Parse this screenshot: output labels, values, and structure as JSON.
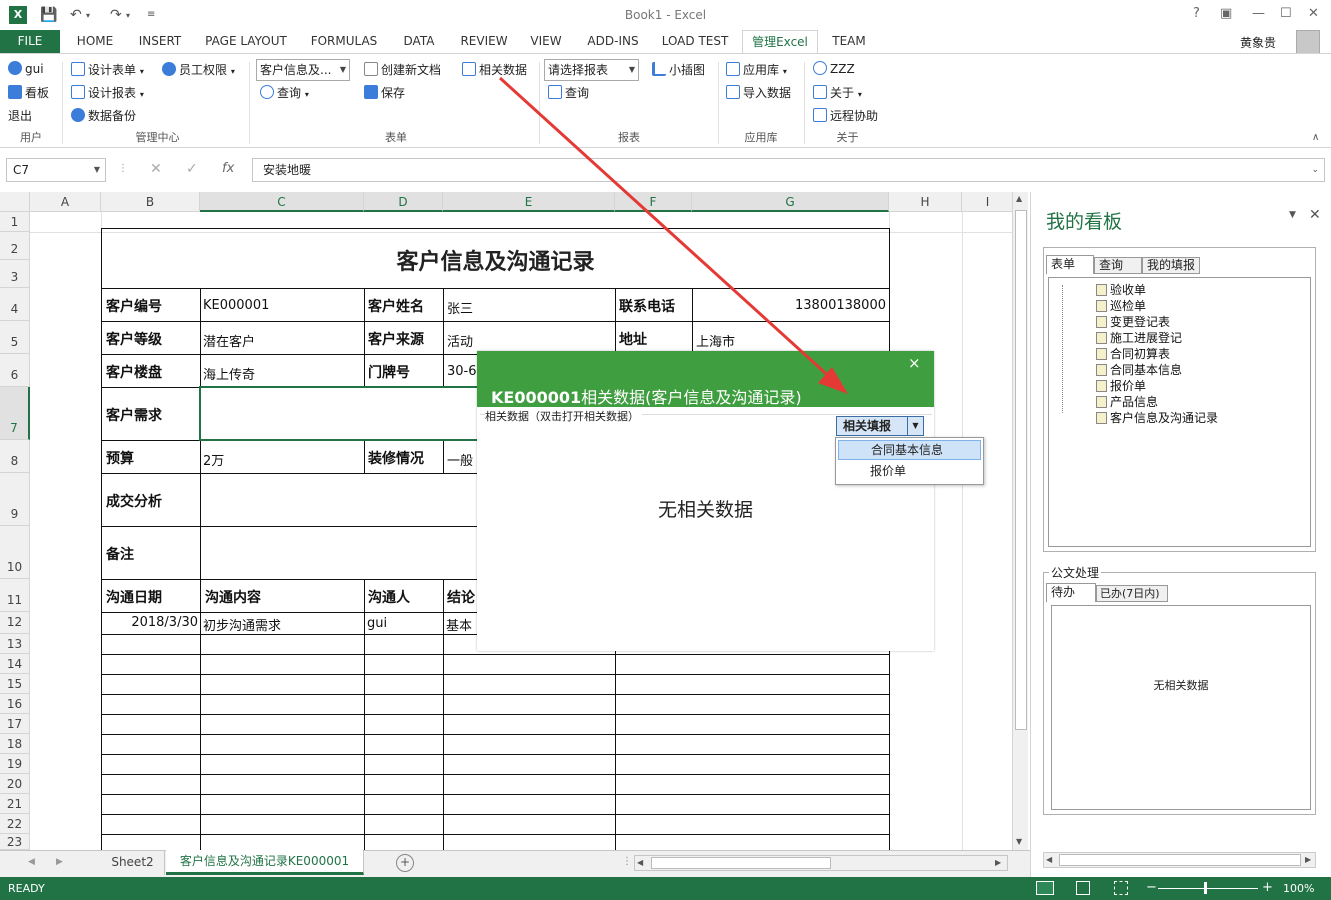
{
  "window": {
    "title": "Book1 - Excel",
    "user": "黄象贵"
  },
  "tabs": [
    {
      "label": "FILE"
    },
    {
      "label": "HOME"
    },
    {
      "label": "INSERT"
    },
    {
      "label": "PAGE LAYOUT"
    },
    {
      "label": "FORMULAS"
    },
    {
      "label": "DATA"
    },
    {
      "label": "REVIEW"
    },
    {
      "label": "VIEW"
    },
    {
      "label": "ADD-INS"
    },
    {
      "label": "LOAD TEST"
    },
    {
      "label": "管理Excel"
    },
    {
      "label": "TEAM"
    }
  ],
  "ribbon": {
    "user": {
      "name": "gui",
      "board": "看板",
      "logout": "退出",
      "group": "用户"
    },
    "admin": {
      "design_form": "设计表单",
      "design_report": "设计报表",
      "backup": "数据备份",
      "staff_perm": "员工权限",
      "group": "管理中心"
    },
    "form": {
      "combo": "客户信息及...",
      "query": "查询",
      "new_doc": "创建新文档",
      "save": "保存",
      "related": "相关数据",
      "group": "表单"
    },
    "report": {
      "combo": "请选择报表",
      "query": "查询",
      "chart": "小插图",
      "group": "报表"
    },
    "apps": {
      "library": "应用库",
      "import": "导入数据",
      "group": "应用库"
    },
    "about": {
      "zzz": "ZZZ",
      "about": "关于",
      "remote": "远程协助",
      "group": "关于"
    }
  },
  "formula_bar": {
    "name_box": "C7",
    "formula": "安装地暖"
  },
  "columns": [
    "A",
    "B",
    "C",
    "D",
    "E",
    "F",
    "G",
    "H",
    "I"
  ],
  "rows": [
    "1",
    "2",
    "3",
    "4",
    "5",
    "6",
    "7",
    "8",
    "9",
    "10",
    "11",
    "12",
    "13",
    "14",
    "15",
    "16",
    "17",
    "18",
    "19",
    "20",
    "21",
    "22",
    "23"
  ],
  "sheet": {
    "title": "客户信息及沟通记录",
    "labels": {
      "cust_no": "客户编号",
      "cust_name": "客户姓名",
      "phone": "联系电话",
      "level": "客户等级",
      "source": "客户来源",
      "address": "地址",
      "building": "客户楼盘",
      "door": "门牌号",
      "needs": "客户需求",
      "budget": "预算",
      "decor": "装修情况",
      "analysis": "成交分析",
      "remark": "备注",
      "comm_date": "沟通日期",
      "comm_content": "沟通内容",
      "comm_person": "沟通人",
      "conclusion": "结论"
    },
    "values": {
      "cust_no": "KE000001",
      "cust_name": "张三",
      "phone": "13800138000",
      "level": "潜在客户",
      "source": "活动",
      "address": "上海市",
      "building": "海上传奇",
      "door": "30-6",
      "budget": "2万",
      "decor": "一般"
    },
    "log": [
      {
        "date": "2018/3/30",
        "content": "初步沟通需求",
        "person": "gui",
        "conclusion": "基本"
      }
    ]
  },
  "dialog": {
    "id": "KE000001",
    "title_rest": "相关数据(客户信息及沟通记录)",
    "close": "×",
    "hint": "相关数据（双击打开相关数据）",
    "empty": "无相关数据",
    "fill_btn": "相关填报",
    "dropdown": [
      "合同基本信息",
      "报价单"
    ]
  },
  "taskpane": {
    "title": "我的看板",
    "tabs": [
      "表单",
      "查询",
      "我的填报"
    ],
    "tree": [
      "验收单",
      "巡检单",
      "变更登记表",
      "施工进展登记",
      "合同初算表",
      "合同基本信息",
      "报价单",
      "产品信息",
      "客户信息及沟通记录"
    ],
    "doc_section": "公文处理",
    "doc_tabs": [
      "待办",
      "已办(7日内)"
    ],
    "doc_empty": "无相关数据"
  },
  "sheet_tabs": [
    "Sheet2",
    "客户信息及沟通记录KE000001"
  ],
  "status": {
    "ready": "READY",
    "zoom": "100%"
  },
  "colors": {
    "excel_green": "#217346",
    "dialog_green": "#3f9e3f",
    "arrow_red": "#e53935"
  }
}
